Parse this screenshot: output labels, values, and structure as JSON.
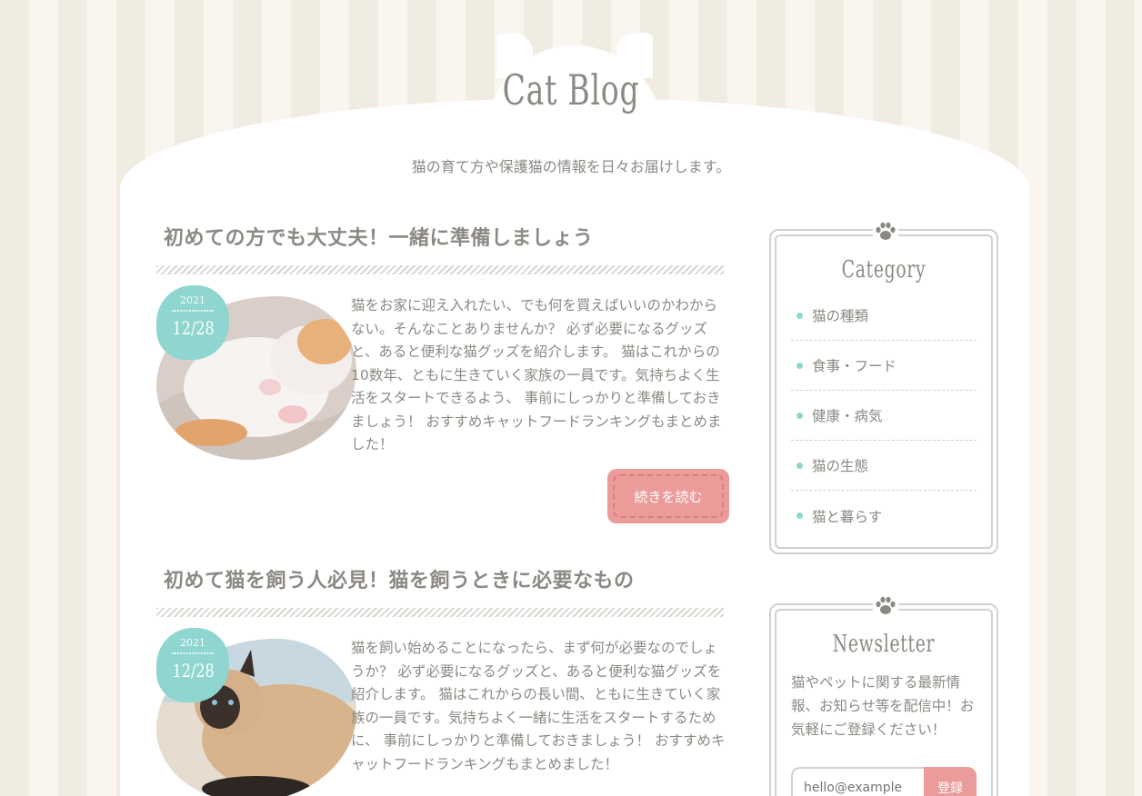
{
  "header": {
    "site_title": "Cat Blog",
    "tagline": "猫の育て方や保護猫の情報を日々お届けします。"
  },
  "posts": [
    {
      "title": "初めての方でも大丈夫！一緒に準備しましょう",
      "date_year": "2021",
      "date_day": "12/28",
      "excerpt": "猫をお家に迎え入れたい、でも何を買えばいいのかわからない。そんなことありませんか？ 必ず必要になるグッズと、あると便利な猫グッズを紹介します。 猫はこれからの10数年、ともに生きていく家族の一員です。気持ちよく生活をスタートできるよう、 事前にしっかりと準備しておきましょう！ おすすめキャットフードランキングもまとめました！",
      "read_more": "続きを読む"
    },
    {
      "title": "初めて猫を飼う人必見！猫を飼うときに必要なもの",
      "date_year": "2021",
      "date_day": "12/28",
      "excerpt": "猫を飼い始めることになったら、まず何が必要なのでしょうか？ 必ず必要になるグッズと、あると便利な猫グッズを紹介します。 猫はこれからの長い間、ともに生きていく家族の一員です。気持ちよく一緒に生活をスタートするために、 事前にしっかりと準備しておきましょう！ おすすめキャットフードランキングもまとめました！"
    }
  ],
  "sidebar": {
    "category": {
      "title": "Category",
      "items": [
        "猫の種類",
        "食事・フード",
        "健康・病気",
        "猫の生態",
        "猫と暮らす"
      ]
    },
    "newsletter": {
      "title": "Newsletter",
      "text": "猫やペットに関する最新情報、お知らせ等を配信中！お気軽にご登録ください！",
      "placeholder": "hello@example",
      "button": "登録"
    }
  },
  "colors": {
    "accent_teal": "#8ed6cf",
    "accent_pink": "#ec9b9b",
    "text": "#8c8984"
  }
}
